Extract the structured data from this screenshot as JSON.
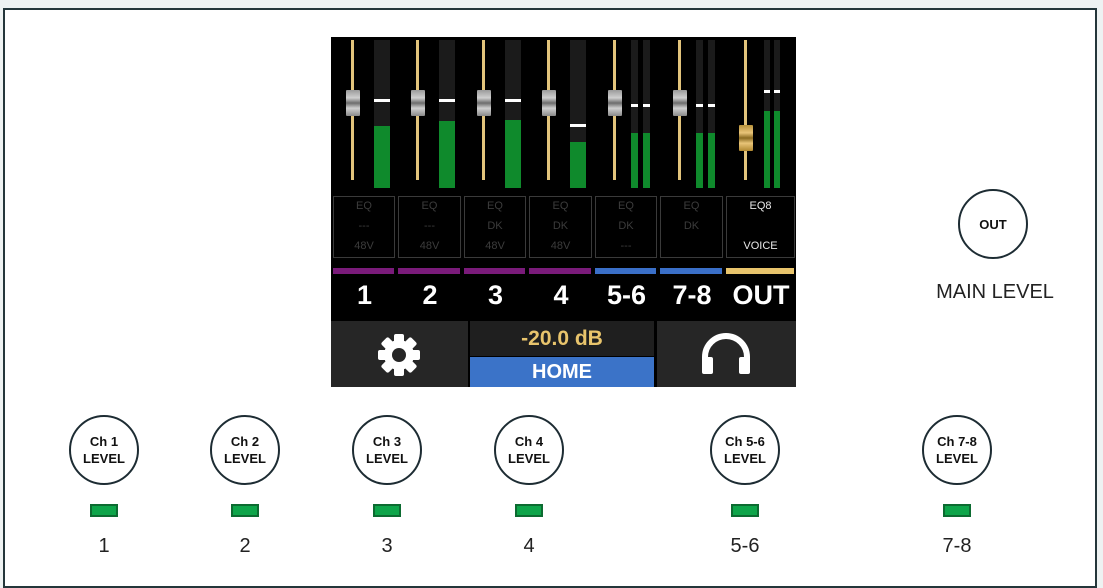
{
  "mixer": {
    "channels": [
      {
        "id": "1",
        "fader": 0.7,
        "meter": 0.42,
        "peak": 0.6,
        "color": "#7a1b7a",
        "box": [
          "EQ",
          "---",
          "48V"
        ],
        "label": "1"
      },
      {
        "id": "2",
        "fader": 0.7,
        "meter": 0.45,
        "peak": 0.6,
        "color": "#7a1b7a",
        "box": [
          "EQ",
          "---",
          "48V"
        ],
        "label": "2"
      },
      {
        "id": "3",
        "fader": 0.7,
        "meter": 0.46,
        "peak": 0.6,
        "color": "#7a1b7a",
        "box": [
          "EQ",
          "DK",
          "48V"
        ],
        "label": "3"
      },
      {
        "id": "4",
        "fader": 0.7,
        "meter": 0.31,
        "peak": 0.43,
        "color": "#7a1b7a",
        "box": [
          "EQ",
          "DK",
          "48V"
        ],
        "label": "4"
      },
      {
        "id": "5-6",
        "fader": 0.7,
        "meter": 0.37,
        "peak": 0.57,
        "stereo": true,
        "color": "#3a6fc8",
        "box": [
          "EQ",
          "DK",
          "---"
        ],
        "label": "5-6"
      },
      {
        "id": "7-8",
        "fader": 0.7,
        "meter": 0.37,
        "peak": 0.57,
        "stereo": true,
        "color": "#3a6fc8",
        "box": [
          "EQ",
          "DK",
          ""
        ],
        "label": "7-8"
      },
      {
        "id": "OUT",
        "fader": 0.45,
        "meter": 0.52,
        "peak": 0.66,
        "stereo": true,
        "color": "#e8c46c",
        "box": [
          "EQ8",
          "",
          "VOICE"
        ],
        "label": "OUT"
      }
    ],
    "level": "-20.0 dB",
    "home": "HOME",
    "settings_icon": "gear-icon",
    "headphones_icon": "headphones-icon"
  },
  "knobs": [
    {
      "text": "Ch 1\nLEVEL",
      "led": "1"
    },
    {
      "text": "Ch 2\nLEVEL",
      "led": "2"
    },
    {
      "text": "Ch 3\nLEVEL",
      "led": "3"
    },
    {
      "text": "Ch 4\nLEVEL",
      "led": "4"
    },
    {
      "text": "Ch 5-6\nLEVEL",
      "led": "5-6"
    },
    {
      "text": "Ch 7-8\nLEVEL",
      "led": "7-8"
    }
  ],
  "out_knob": {
    "text": "OUT",
    "label": "MAIN LEVEL"
  },
  "colors": {
    "meter_green": "#0f8a2c",
    "fader_gold": "#e2c47c",
    "home_blue": "#3b73c8",
    "led_green": "#0ea54a"
  }
}
